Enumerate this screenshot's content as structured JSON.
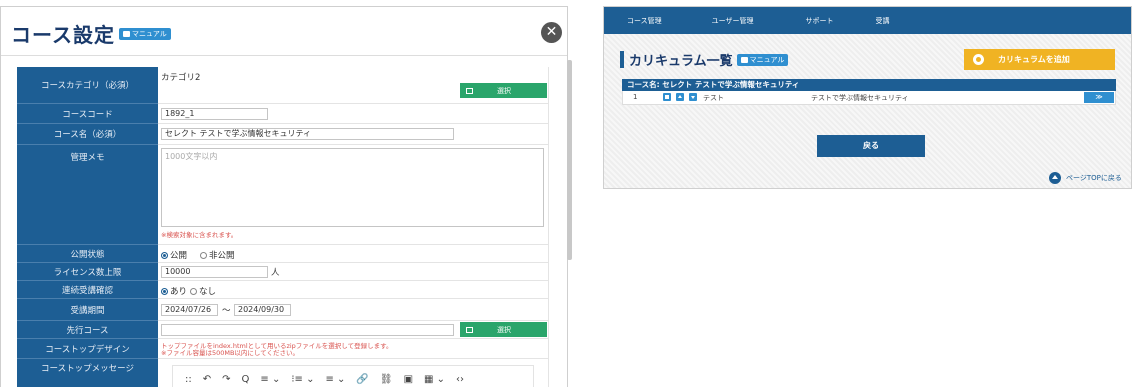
{
  "modal": {
    "title": "コース設定",
    "manual": "マニュアル",
    "close": "✕",
    "fields": {
      "category": {
        "label": "コースカテゴリ（必須）",
        "value": "カテゴリ2",
        "button": "選択"
      },
      "code": {
        "label": "コースコード",
        "value": "1892_1"
      },
      "name": {
        "label": "コース名（必須）",
        "value": "セレクト テストで学ぶ情報セキュリティ"
      },
      "memo": {
        "label": "管理メモ",
        "placeholder": "1000文字以内",
        "note": "※検索対象に含まれます。"
      },
      "status": {
        "label": "公開状態",
        "opt1": "公開",
        "opt2": "非公開"
      },
      "license": {
        "label": "ライセンス数上限",
        "value": "10000",
        "unit": "人"
      },
      "confirm": {
        "label": "連続受講確認",
        "opt1": "あり",
        "opt2": "なし"
      },
      "period": {
        "label": "受講期間",
        "from": "2024/07/26",
        "sep": "～",
        "to": "2024/09/30"
      },
      "prior": {
        "label": "先行コース",
        "button": "選択"
      },
      "design": {
        "label": "コーストップデザイン",
        "note1": "トップファイルをindex.htmlとして用いるzipファイルを選択して登録します。",
        "note2": "※ファイル容量は500MB以内にしてください。"
      },
      "message": {
        "label": "コーストップメッセージ"
      }
    },
    "toolbar": [
      "::",
      "↶",
      "↷",
      "Q",
      "≡ ⌄",
      "⁝≡ ⌄",
      "≡ ⌄",
      "🔗",
      "⛓",
      "▣",
      "▦ ⌄",
      "‹›"
    ]
  },
  "panel": {
    "nav": [
      "コース管理",
      "ユーザー管理",
      "サポート",
      "受講"
    ],
    "title": "カリキュラム一覧",
    "manual": "マニュアル",
    "add": "カリキュラムを追加",
    "course_label": "コース名: セレクト テストで学ぶ情報セキュリティ",
    "row": {
      "no": "1",
      "type": "テスト",
      "name": "テストで学ぶ情報セキュリティ",
      "expand": "≫"
    },
    "back": "戻る",
    "pagetop": "ページTOPに戻る"
  },
  "colors": {
    "primary": "#1d5e94",
    "accent_green": "#2aa56b",
    "accent_yellow": "#f0b323",
    "badge_blue": "#2f8fd0"
  }
}
